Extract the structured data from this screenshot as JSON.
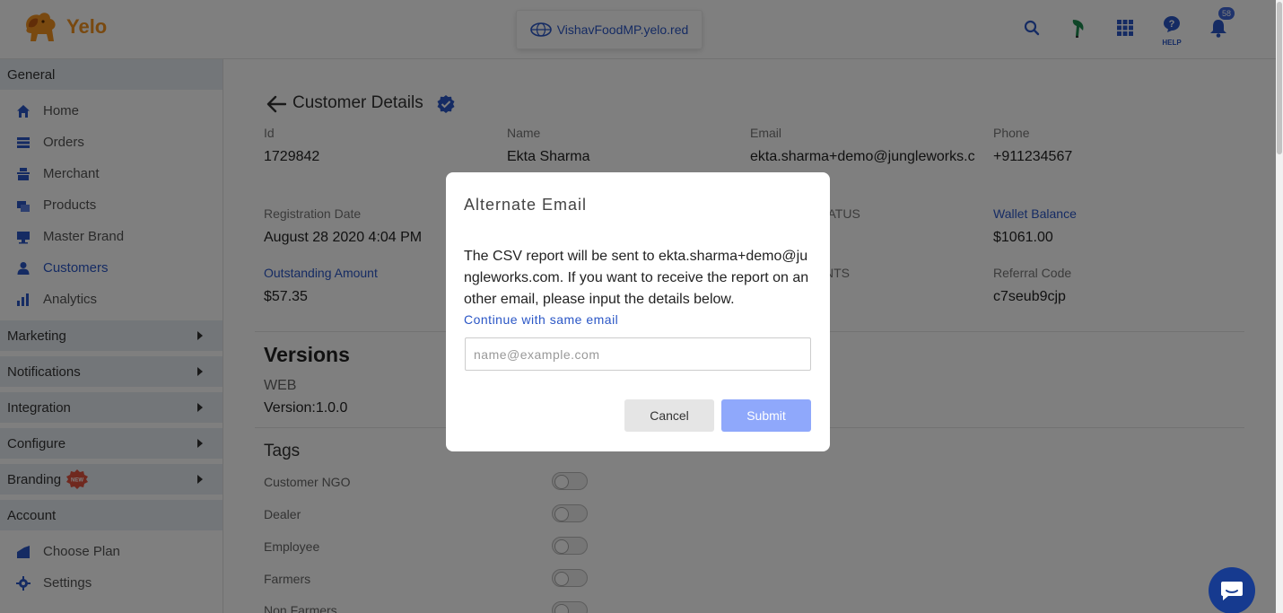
{
  "header": {
    "brand": "Yelo",
    "domain": "VishavFoodMP.yelo.red",
    "help_label": "HELP",
    "notification_count": "58",
    "icons": [
      "search-icon",
      "leaf-icon",
      "apps-grid-icon",
      "help-icon",
      "bell-icon"
    ]
  },
  "sidebar": {
    "general": "General",
    "items": [
      {
        "label": "Home",
        "icon": "home-icon"
      },
      {
        "label": "Orders",
        "icon": "orders-icon"
      },
      {
        "label": "Merchant",
        "icon": "merchant-icon"
      },
      {
        "label": "Products",
        "icon": "products-icon"
      },
      {
        "label": "Master Brand",
        "icon": "master-brand-icon"
      },
      {
        "label": "Customers",
        "icon": "customers-icon"
      },
      {
        "label": "Analytics",
        "icon": "analytics-icon"
      }
    ],
    "marketing": "Marketing",
    "notifications": "Notifications",
    "integration": "Integration",
    "configure": "Configure",
    "branding": "Branding",
    "branding_badge": "NEW",
    "account": "Account",
    "account_items": [
      {
        "label": "Choose Plan",
        "icon": "choose-plan-icon"
      },
      {
        "label": "Settings",
        "icon": "settings-icon"
      }
    ],
    "active_color": "#2a56c6"
  },
  "customer": {
    "title": "Customer Details",
    "id_label": "Id",
    "id_value": "1729842",
    "name_label": "Name",
    "name_value": "Ekta Sharma",
    "email_label": "Email",
    "email_value": "ekta.sharma+demo@jungleworks.c",
    "phone_label": "Phone",
    "phone_value": "+911234567",
    "reg_label": "Registration Date",
    "reg_value": "August 28 2020 4:04 PM",
    "status_label_partial": "TATUS",
    "wallet_label": "Wallet Balance",
    "wallet_value": "$1061.00",
    "outstanding_label": "Outstanding Amount",
    "outstanding_value": "$57.35",
    "nts_label_partial": "NTS",
    "referral_label": "Referral Code",
    "referral_value": "c7seub9cjp"
  },
  "versions": {
    "title": "Versions",
    "platform": "WEB",
    "version": "Version:1.0.0"
  },
  "tags": {
    "title": "Tags",
    "items": [
      "Customer NGO",
      "Dealer",
      "Employee",
      "Farmers",
      "Non Farmers"
    ]
  },
  "modal": {
    "title": "Alternate Email",
    "body": "The CSV report will be sent to ekta.sharma+demo@jungleworks.com. If you want to receive the report on another email, please input the details below.",
    "same_email_link": "Continue with same email",
    "input_placeholder": "name@example.com",
    "input_value": "",
    "cancel_label": "Cancel",
    "submit_label": "Submit",
    "submit_color": "#8fa8fb"
  }
}
